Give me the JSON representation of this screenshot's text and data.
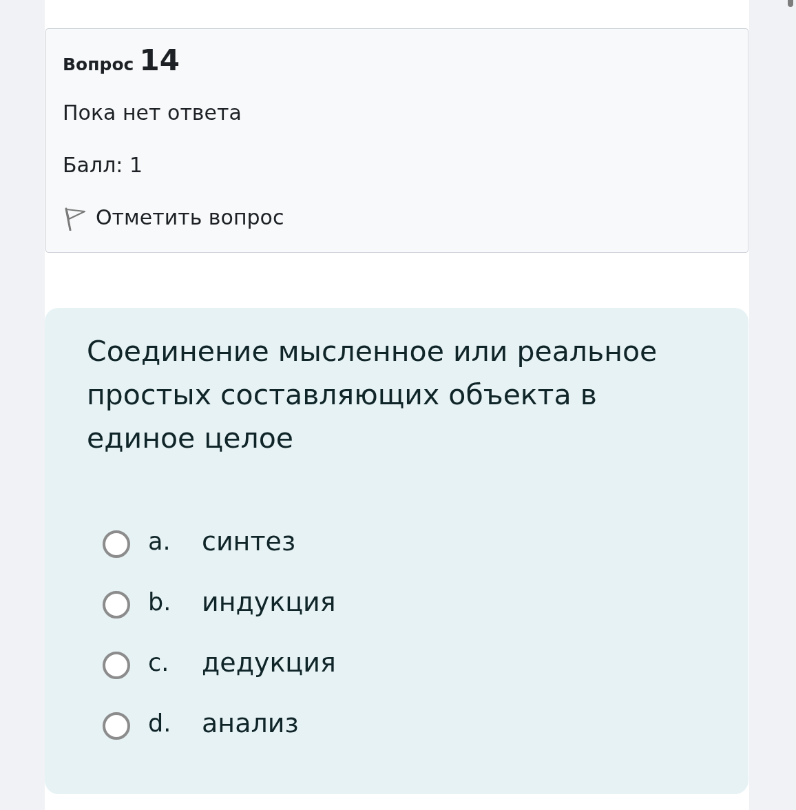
{
  "info": {
    "label": "Вопрос",
    "number": "14",
    "status": "Пока нет ответа",
    "grade": "Балл: 1",
    "flag": {
      "label": "Отметить вопрос",
      "flagged": false
    }
  },
  "question": {
    "text": "Соединение мысленное или реальное простых составляющих объекта в единое целое",
    "options": [
      {
        "letter": "a.",
        "text": "синтез",
        "selected": false
      },
      {
        "letter": "b.",
        "text": "индукция",
        "selected": false
      },
      {
        "letter": "c.",
        "text": "дедукция",
        "selected": false
      },
      {
        "letter": "d.",
        "text": "анализ",
        "selected": false
      }
    ]
  }
}
